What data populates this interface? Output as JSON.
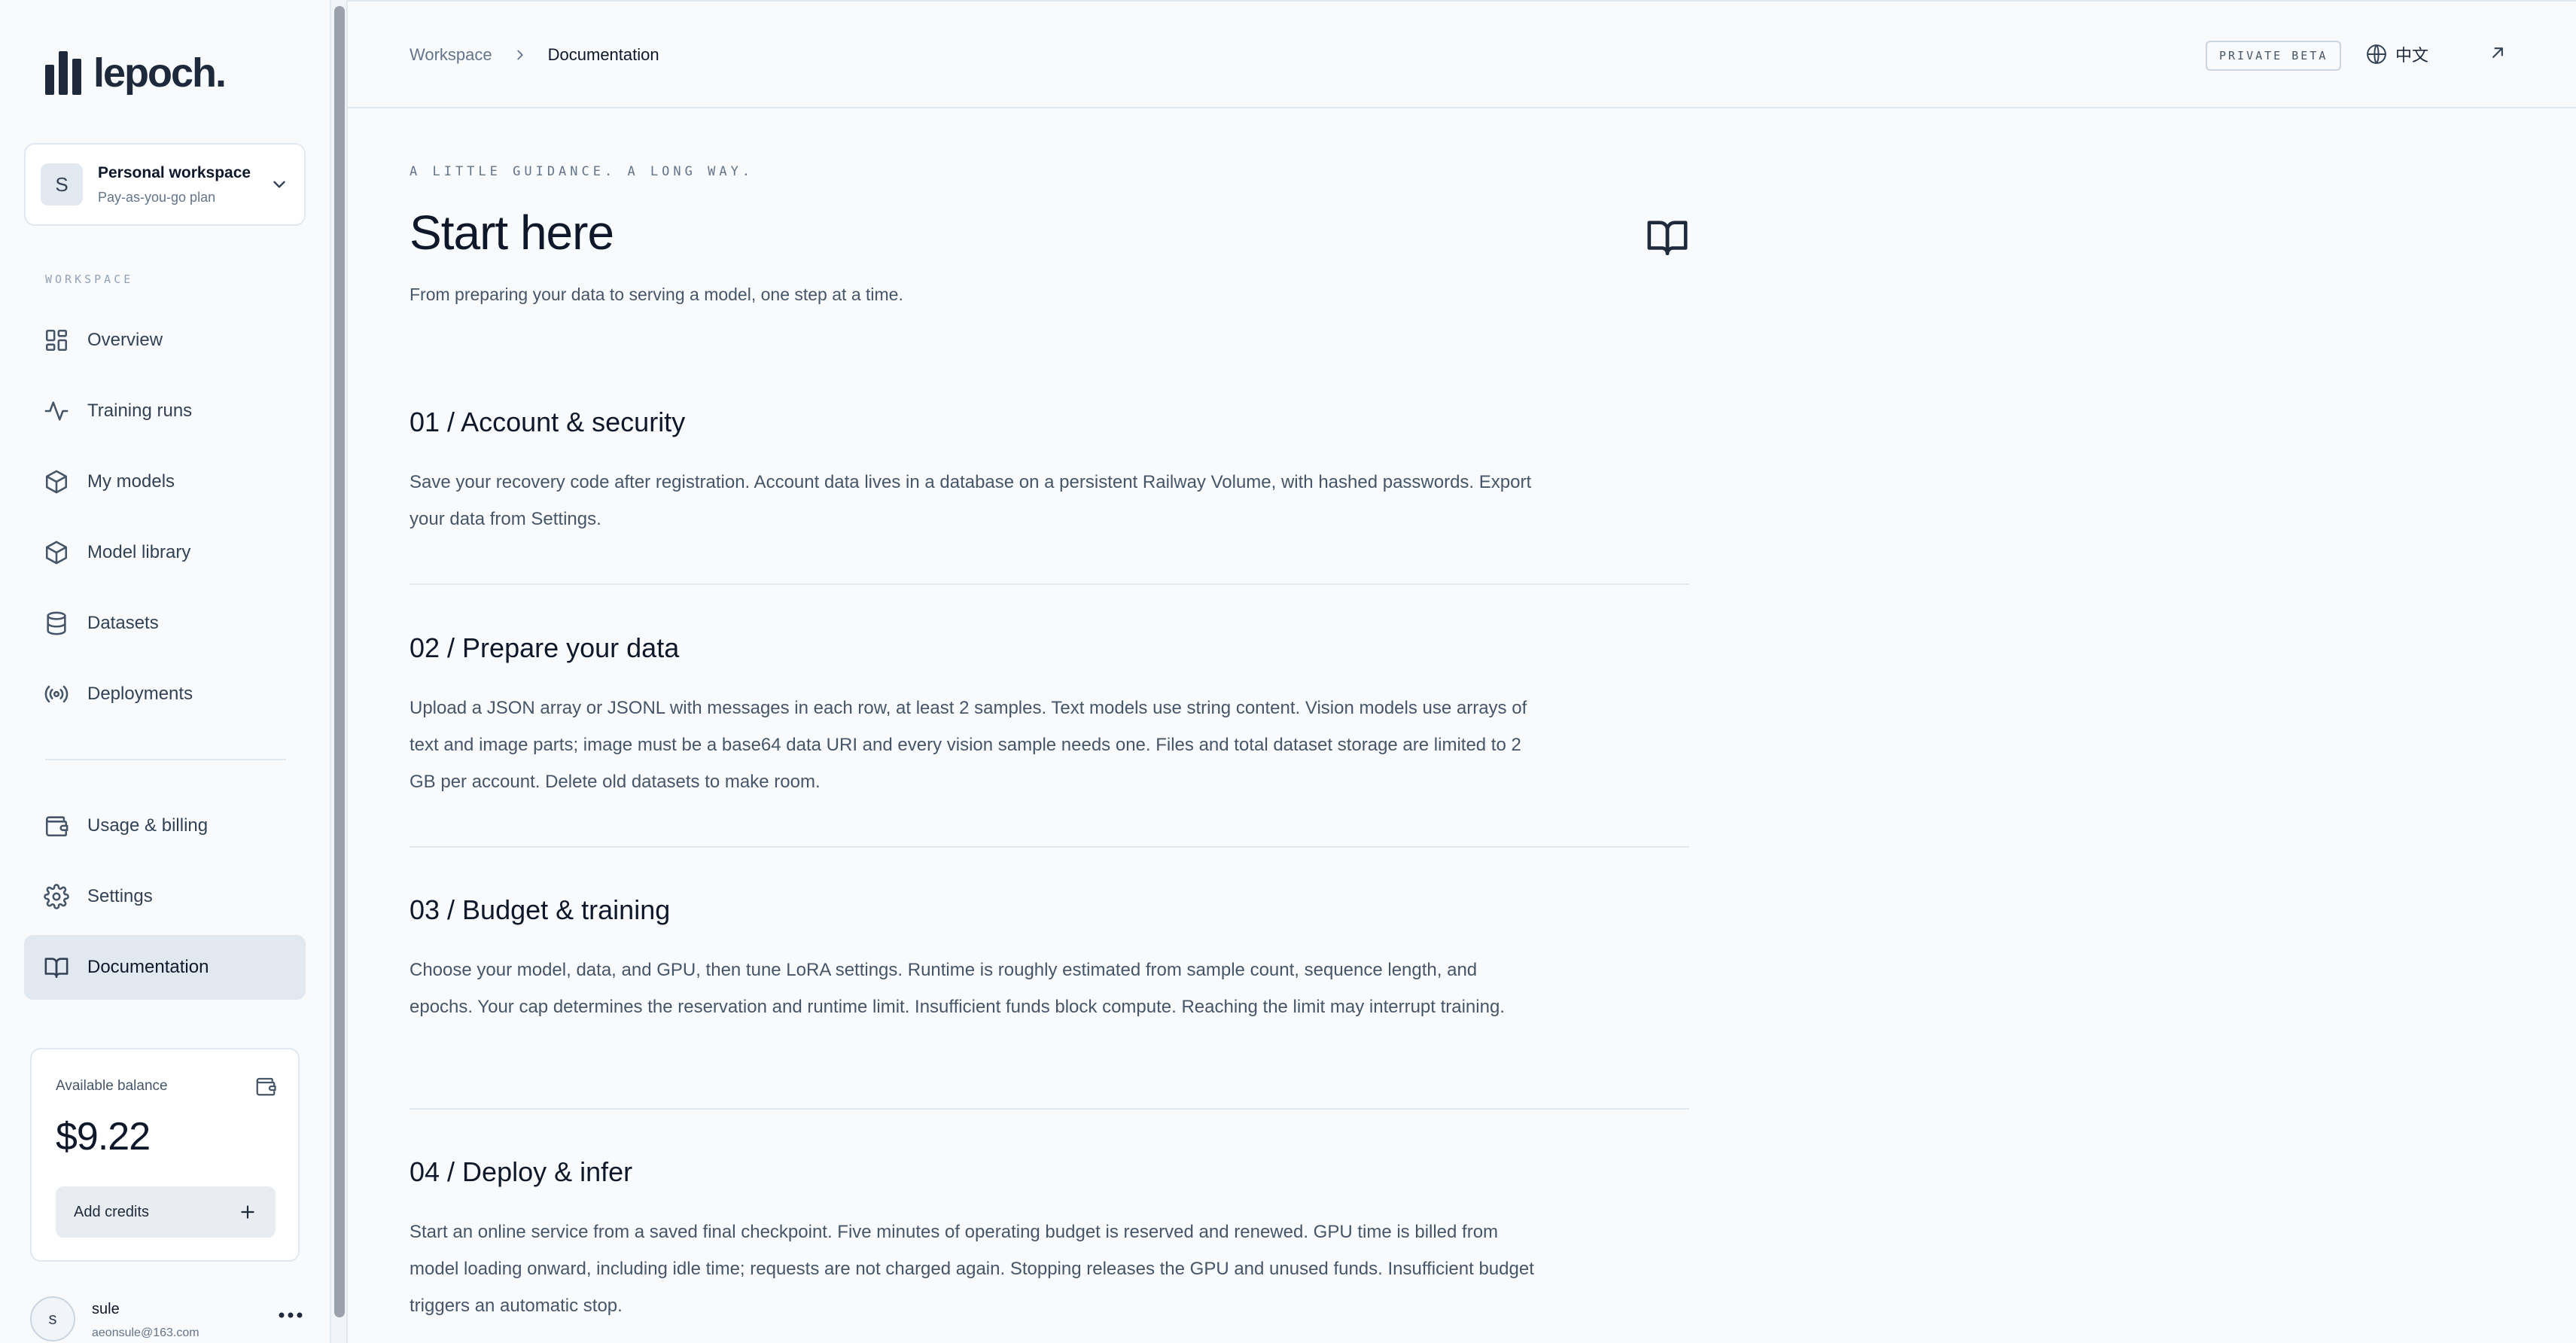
{
  "brand": {
    "name": "lepoch."
  },
  "workspace": {
    "avatar_letter": "S",
    "name": "Personal workspace",
    "plan": "Pay-as-you-go plan"
  },
  "sidebar": {
    "section_label": "WORKSPACE",
    "items": [
      {
        "label": "Overview",
        "icon": "grid-icon"
      },
      {
        "label": "Training runs",
        "icon": "activity-icon"
      },
      {
        "label": "My models",
        "icon": "box-icon"
      },
      {
        "label": "Model library",
        "icon": "box-icon"
      },
      {
        "label": "Datasets",
        "icon": "database-icon"
      },
      {
        "label": "Deployments",
        "icon": "broadcast-icon"
      },
      {
        "label": "Usage & billing",
        "icon": "wallet-icon"
      },
      {
        "label": "Settings",
        "icon": "gear-icon"
      },
      {
        "label": "Documentation",
        "icon": "book-icon",
        "active": true
      }
    ]
  },
  "balance": {
    "label": "Available balance",
    "amount": "$9.22",
    "add_credits_label": "Add credits"
  },
  "user": {
    "avatar_letter": "s",
    "name": "sule",
    "email": "aeonsule@163.com"
  },
  "header": {
    "breadcrumb": [
      "Workspace",
      "Documentation"
    ],
    "badge": "PRIVATE BETA",
    "language": "中文"
  },
  "page": {
    "kicker": "A LITTLE GUIDANCE. A LONG WAY.",
    "title": "Start here",
    "subtitle": "From preparing your data to serving a model, one step at a time.",
    "sections": [
      {
        "heading": "01 / Account & security",
        "body": "Save your recovery code after registration. Account data lives in a database on a persistent Railway Volume, with hashed passwords. Export your data from Settings."
      },
      {
        "heading": "02 / Prepare your data",
        "body": "Upload a JSON array or JSONL with messages in each row, at least 2 samples. Text models use string content. Vision models use arrays of text and image parts; image must be a base64 data URI and every vision sample needs one. Files and total dataset storage are limited to 2 GB per account. Delete old datasets to make room."
      },
      {
        "heading": "03 / Budget & training",
        "body": "Choose your model, data, and GPU, then tune LoRA settings. Runtime is roughly estimated from sample count, sequence length, and epochs. Your cap determines the reservation and runtime limit. Insufficient funds block compute. Reaching the limit may interrupt training."
      },
      {
        "heading": "04 / Deploy & infer",
        "body": "Start an online service from a saved final checkpoint. Five minutes of operating budget is reserved and renewed. GPU time is billed from model loading onward, including idle time; requests are not charged again. Stopping releases the GPU and unused funds. Insufficient budget triggers an automatic stop."
      }
    ]
  }
}
